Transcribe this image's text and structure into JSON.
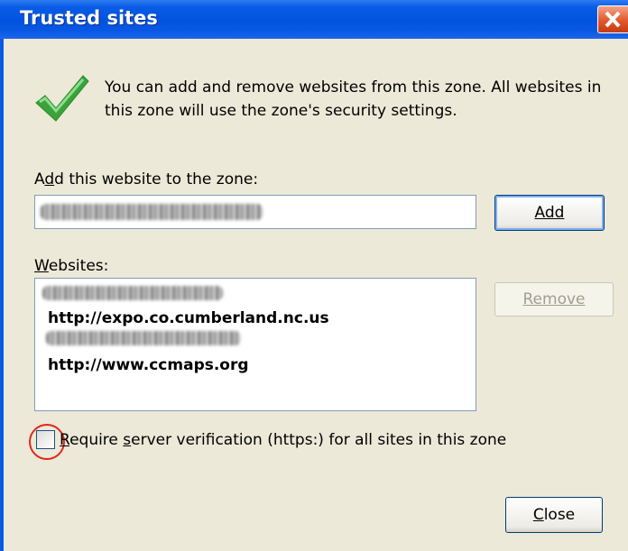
{
  "window": {
    "title": "Trusted sites",
    "message_line1": "You can add and remove websites from this zone. All websites in",
    "message_line2": "this zone will use the zone's security settings."
  },
  "add_section": {
    "label_pre": "A",
    "label_u": "d",
    "label_post": "d this website to the zone:",
    "add_button": "Add"
  },
  "websites_section": {
    "label_u": "W",
    "label_post": "ebsites:",
    "items": [
      "http://expo.co.cumberland.nc.us",
      "http://www.ccmaps.org"
    ],
    "remove_button": "Remove"
  },
  "verification": {
    "checked": false,
    "label_u": "R",
    "label_mid1": "equire ",
    "label_u2": "s",
    "label_post": "erver verification (https:) for all sites in this zone"
  },
  "footer": {
    "close_button_u": "C",
    "close_button_post": "lose"
  },
  "colors": {
    "titlebar": "#0053e0",
    "dialog_bg": "#ece9d8",
    "highlight_circle": "#e0281c",
    "check_green": "#3aa33a"
  }
}
